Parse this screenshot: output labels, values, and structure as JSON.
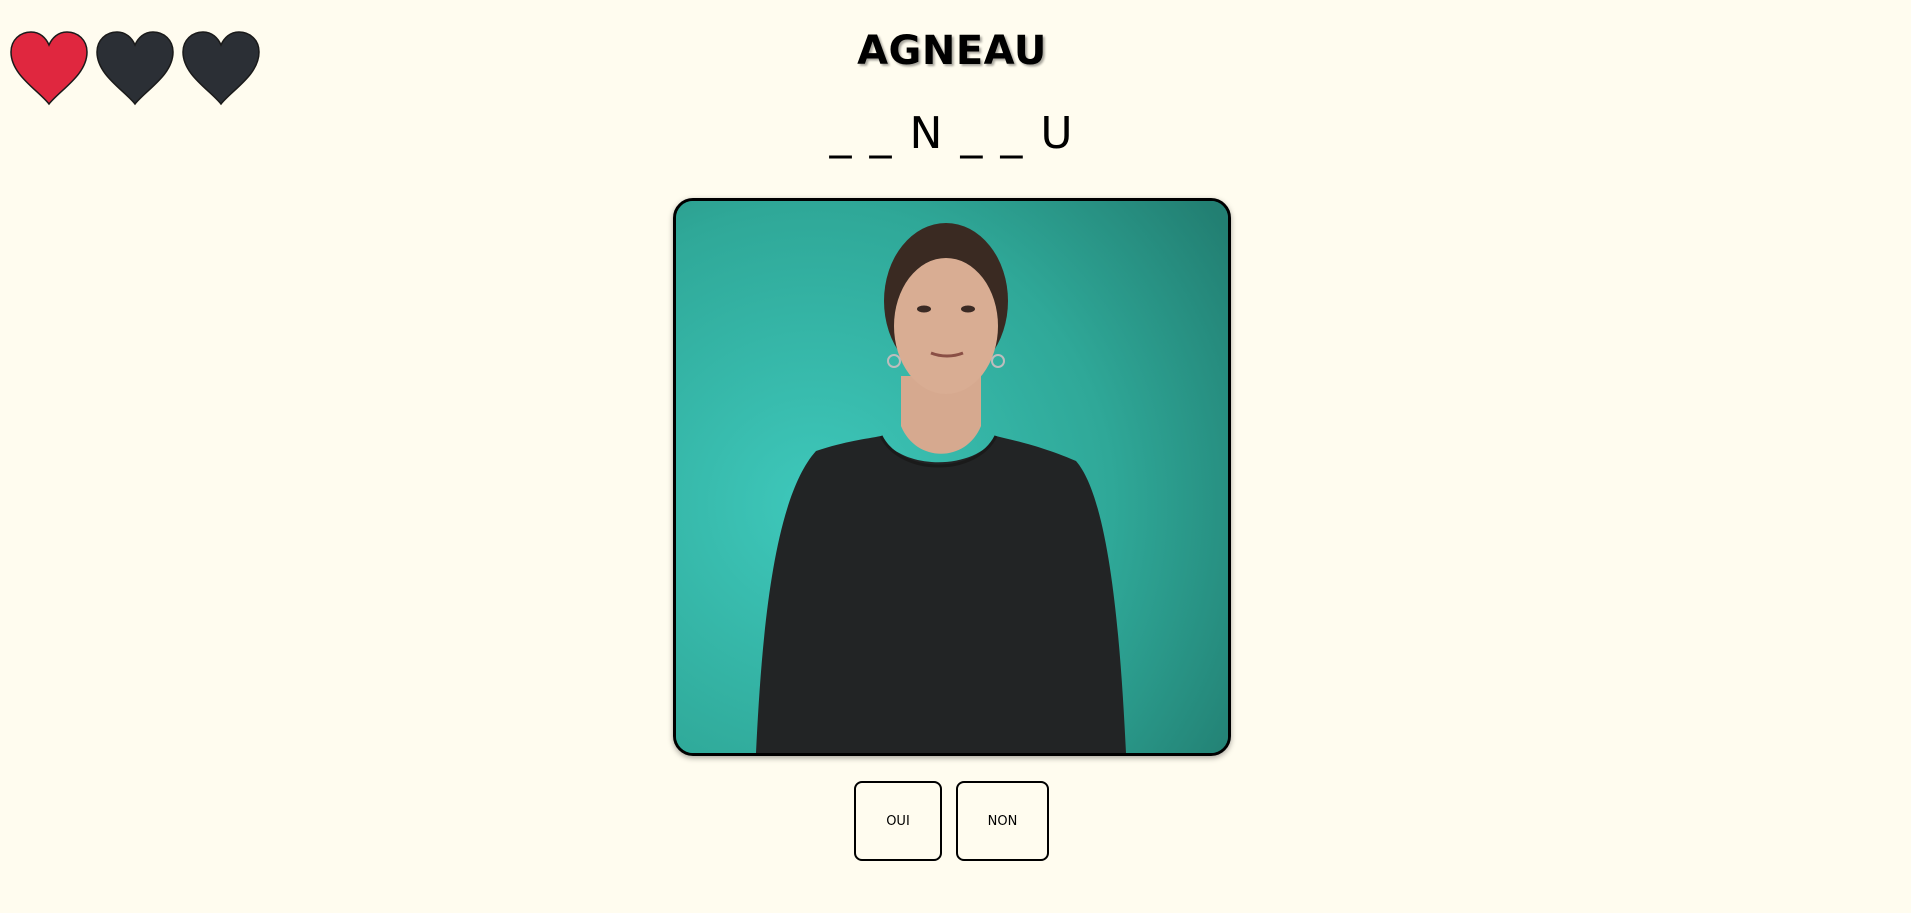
{
  "lives": {
    "total": 3,
    "remaining": 1,
    "colors": {
      "full": "#e0273f",
      "empty": "#2b2f35"
    },
    "icons": [
      "heart-full-icon",
      "heart-empty-icon",
      "heart-empty-icon"
    ]
  },
  "game": {
    "word": "AGNEAU",
    "hint_pattern": "_ _ N _ _ U"
  },
  "video": {
    "content": "sign-language-video"
  },
  "answers": {
    "yes_label": "OUI",
    "no_label": "NON"
  },
  "colors": {
    "background": "#fffcef",
    "video_backdrop": "#2aa99b"
  }
}
